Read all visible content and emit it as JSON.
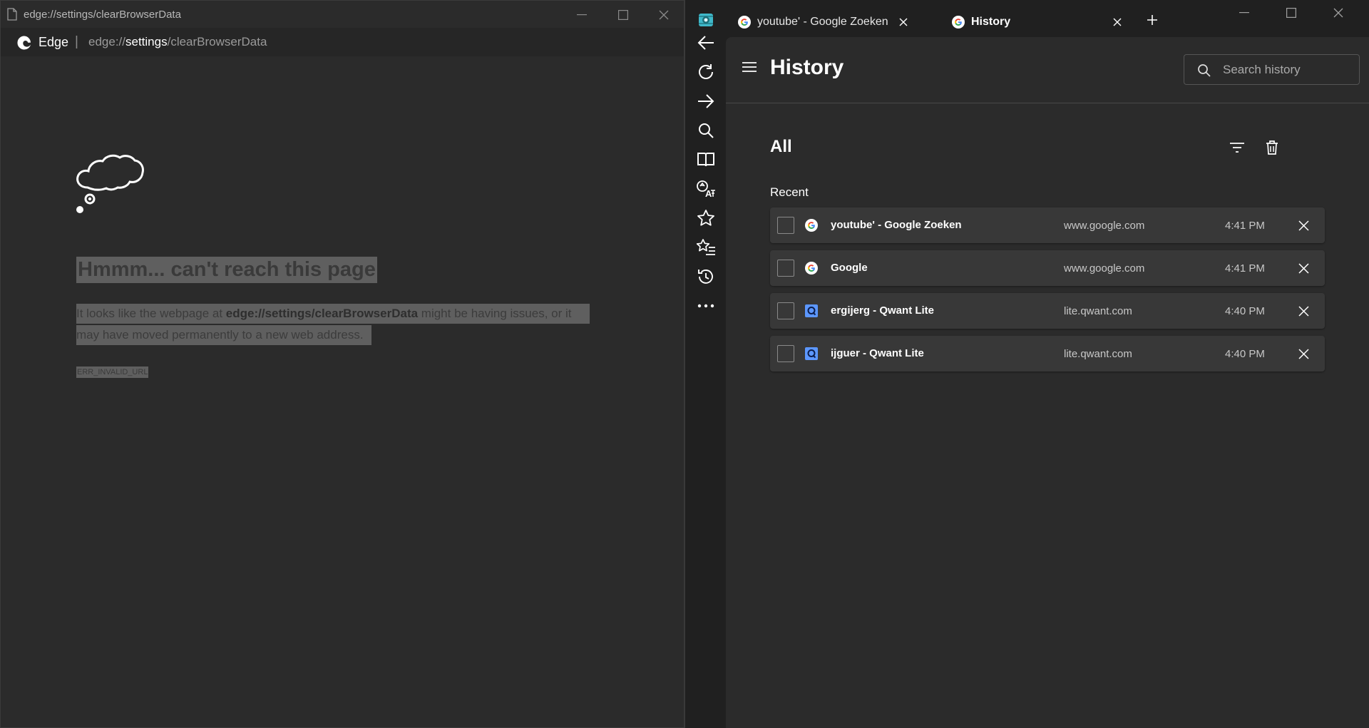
{
  "left_window": {
    "title": "edge://settings/clearBrowserData",
    "address_bar": {
      "brand": "Edge",
      "separator": "|",
      "url_prefix": "edge://",
      "url_host": "settings",
      "url_path": "/clearBrowserData"
    },
    "error": {
      "heading": "Hmmm... can't reach this page",
      "line1_before": "It looks like the webpage at ",
      "line1_bold": "edge://settings/clearBrowserData",
      "line1_after": " might be having issues, or it",
      "line2": "may have moved permanently to a new web address.",
      "code": "ERR_INVALID_URL"
    }
  },
  "right_window": {
    "tabs": [
      {
        "label": "youtube' - Google Zoeken",
        "favicon": "google-g-icon",
        "active": false
      },
      {
        "label": "History",
        "favicon": "google-g-icon",
        "active": true
      }
    ],
    "side_toolbar": [
      "app-logo-icon",
      "back-arrow-icon",
      "reload-icon",
      "forward-arrow-icon",
      "search-icon",
      "reading-view-icon",
      "translate-icon",
      "star-icon",
      "favorites-list-icon",
      "history-icon",
      "more-icon"
    ],
    "history": {
      "title": "History",
      "search_placeholder": "Search history",
      "section": "All",
      "group": "Recent",
      "items": [
        {
          "title": "youtube' - Google Zoeken",
          "domain": "www.google.com",
          "time": "4:41 PM",
          "favicon": "google-g-icon"
        },
        {
          "title": "Google",
          "domain": "www.google.com",
          "time": "4:41 PM",
          "favicon": "google-g-icon"
        },
        {
          "title": "ergijerg - Qwant Lite",
          "domain": "lite.qwant.com",
          "time": "4:40 PM",
          "favicon": "qwant-q-icon"
        },
        {
          "title": "ijguer - Qwant Lite",
          "domain": "lite.qwant.com",
          "time": "4:40 PM",
          "favicon": "qwant-q-icon"
        }
      ]
    },
    "colors": {
      "qwant": "#5c97ff",
      "teal_logo": "#3fb8c9"
    }
  }
}
